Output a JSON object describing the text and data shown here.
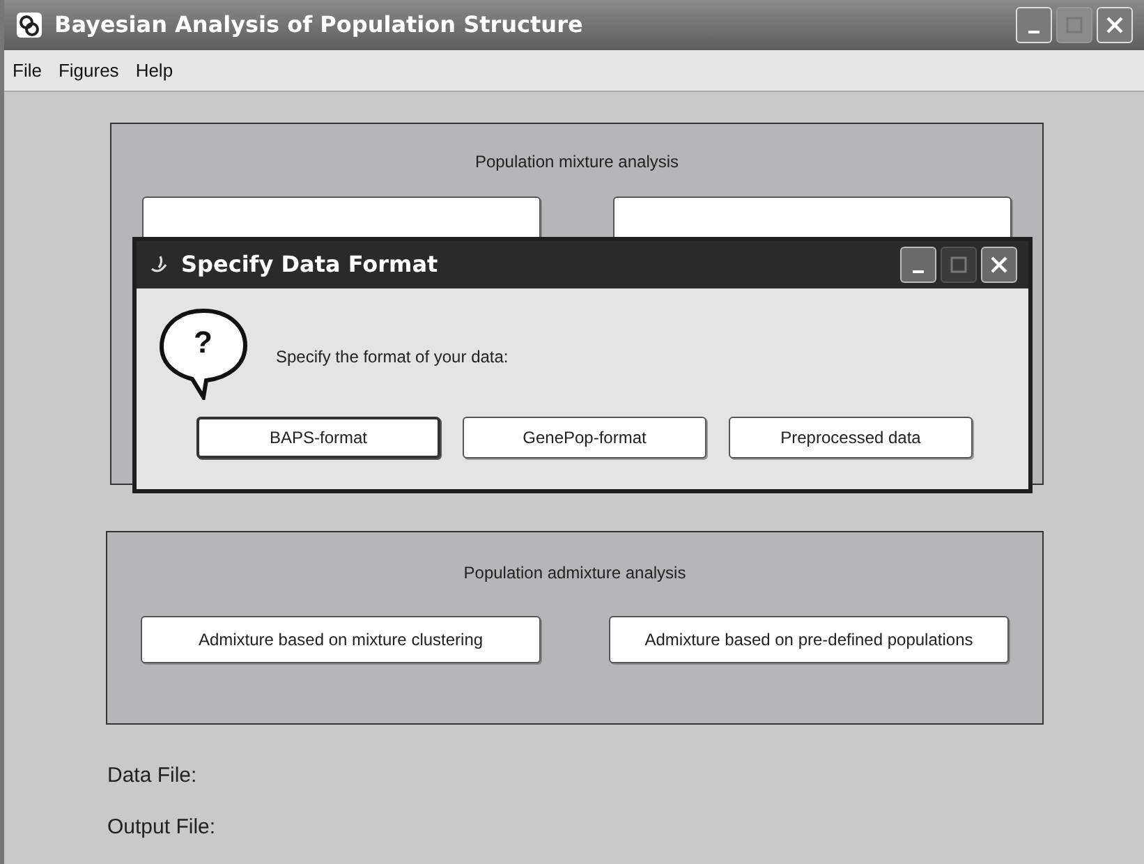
{
  "window": {
    "title": "Bayesian Analysis of Population Structure",
    "controls": [
      {
        "kind": "minimize",
        "disabled": false
      },
      {
        "kind": "maximize",
        "disabled": true
      },
      {
        "kind": "close",
        "disabled": false
      }
    ]
  },
  "menu": [
    "File",
    "Figures",
    "Help"
  ],
  "mixture_panel": {
    "title": "Population mixture analysis"
  },
  "dialog": {
    "title": "Specify Data Format",
    "icon_glyph": "?",
    "message": "Specify the format of your data:",
    "controls": [
      {
        "kind": "minimize",
        "disabled": false
      },
      {
        "kind": "maximize",
        "disabled": true
      },
      {
        "kind": "close",
        "disabled": false
      }
    ],
    "buttons": [
      {
        "label": "BAPS-format",
        "default": true
      },
      {
        "label": "GenePop-format",
        "default": false
      },
      {
        "label": "Preprocessed data",
        "default": false
      }
    ]
  },
  "admixture_panel": {
    "title": "Population admixture analysis",
    "buttons": [
      "Admixture based on mixture clustering",
      "Admixture based on pre-defined populations"
    ]
  },
  "file_labels": [
    "Data File:",
    "Output File:"
  ]
}
